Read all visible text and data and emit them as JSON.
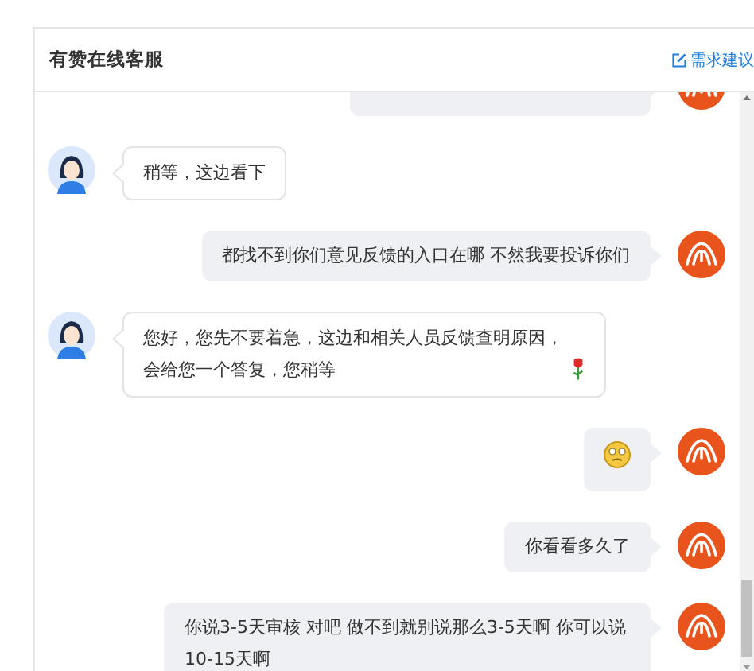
{
  "header": {
    "title": "有赞在线客服",
    "link": "需求建议"
  },
  "messages": [
    {
      "from_agent": false,
      "kind": "cut"
    },
    {
      "from_agent": true,
      "kind": "text",
      "text": "稍等，这边看下"
    },
    {
      "from_agent": false,
      "kind": "text",
      "text": "都找不到你们意见反馈的入口在哪  不然我要投诉你们"
    },
    {
      "from_agent": true,
      "kind": "text-icon",
      "text": "您好，您先不要着急，这边和相关人员反馈查明原因，会给您一个答复，您稍等"
    },
    {
      "from_agent": false,
      "kind": "emoji"
    },
    {
      "from_agent": false,
      "kind": "text",
      "text": "你看看多久了"
    },
    {
      "from_agent": false,
      "kind": "text",
      "text": "你说3-5天审核 对吧  做不到就别说那么3-5天啊  你可以说10-15天啊"
    }
  ]
}
